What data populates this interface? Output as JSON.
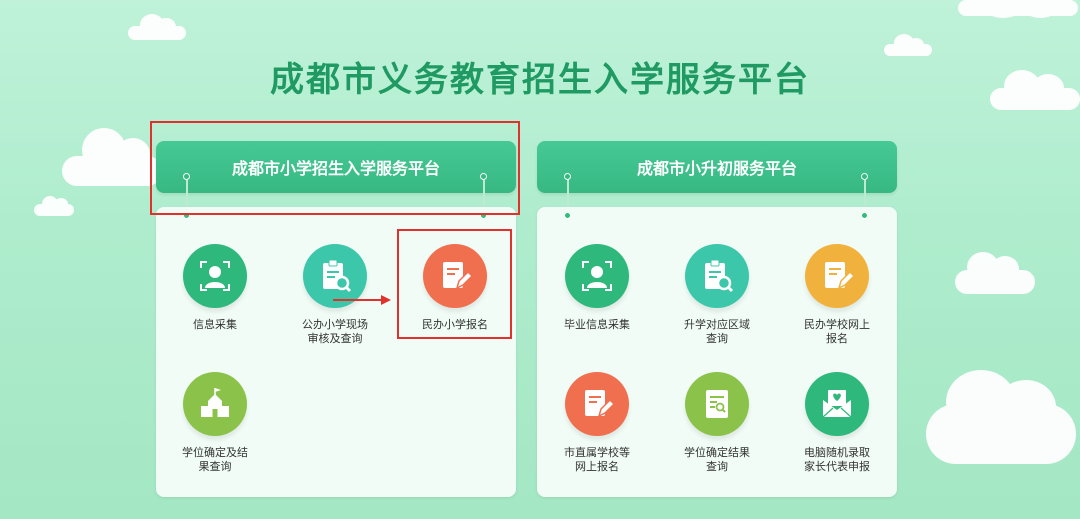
{
  "page": {
    "title": "成都市义务教育招生入学服务平台"
  },
  "panels": {
    "primary": {
      "title": "成都市小学招生入学服务平台",
      "services": [
        {
          "label": "信息采集",
          "icon": "user-profile-icon",
          "color": "#2fb87b"
        },
        {
          "label": "公办小学现场审核及查询",
          "icon": "clipboard-search-icon",
          "color": "#3cc7aa"
        },
        {
          "label": "民办小学报名",
          "icon": "edit-form-icon",
          "color": "#f06f4f"
        },
        {
          "label": "学位确定及结果查询",
          "icon": "school-building-icon",
          "color": "#8bc34a"
        }
      ]
    },
    "junior": {
      "title": "成都市小升初服务平台",
      "services": [
        {
          "label": "毕业信息采集",
          "icon": "user-profile-icon",
          "color": "#2fb87b"
        },
        {
          "label": "升学对应区域查询",
          "icon": "clipboard-search-icon",
          "color": "#3cc7aa"
        },
        {
          "label": "民办学校网上报名",
          "icon": "edit-form-icon",
          "color": "#f0b23d"
        },
        {
          "label": "市直属学校等网上报名",
          "icon": "edit-form-icon",
          "color": "#f06f4f"
        },
        {
          "label": "学位确定结果查询",
          "icon": "document-search-icon",
          "color": "#8bc34a"
        },
        {
          "label": "电脑随机录取家长代表申报",
          "icon": "envelope-heart-icon",
          "color": "#2fb87b"
        }
      ]
    }
  },
  "colors": {
    "accent": "#1f9a62",
    "header_green": "#3cbd88",
    "highlight_red": "#e0312c"
  }
}
